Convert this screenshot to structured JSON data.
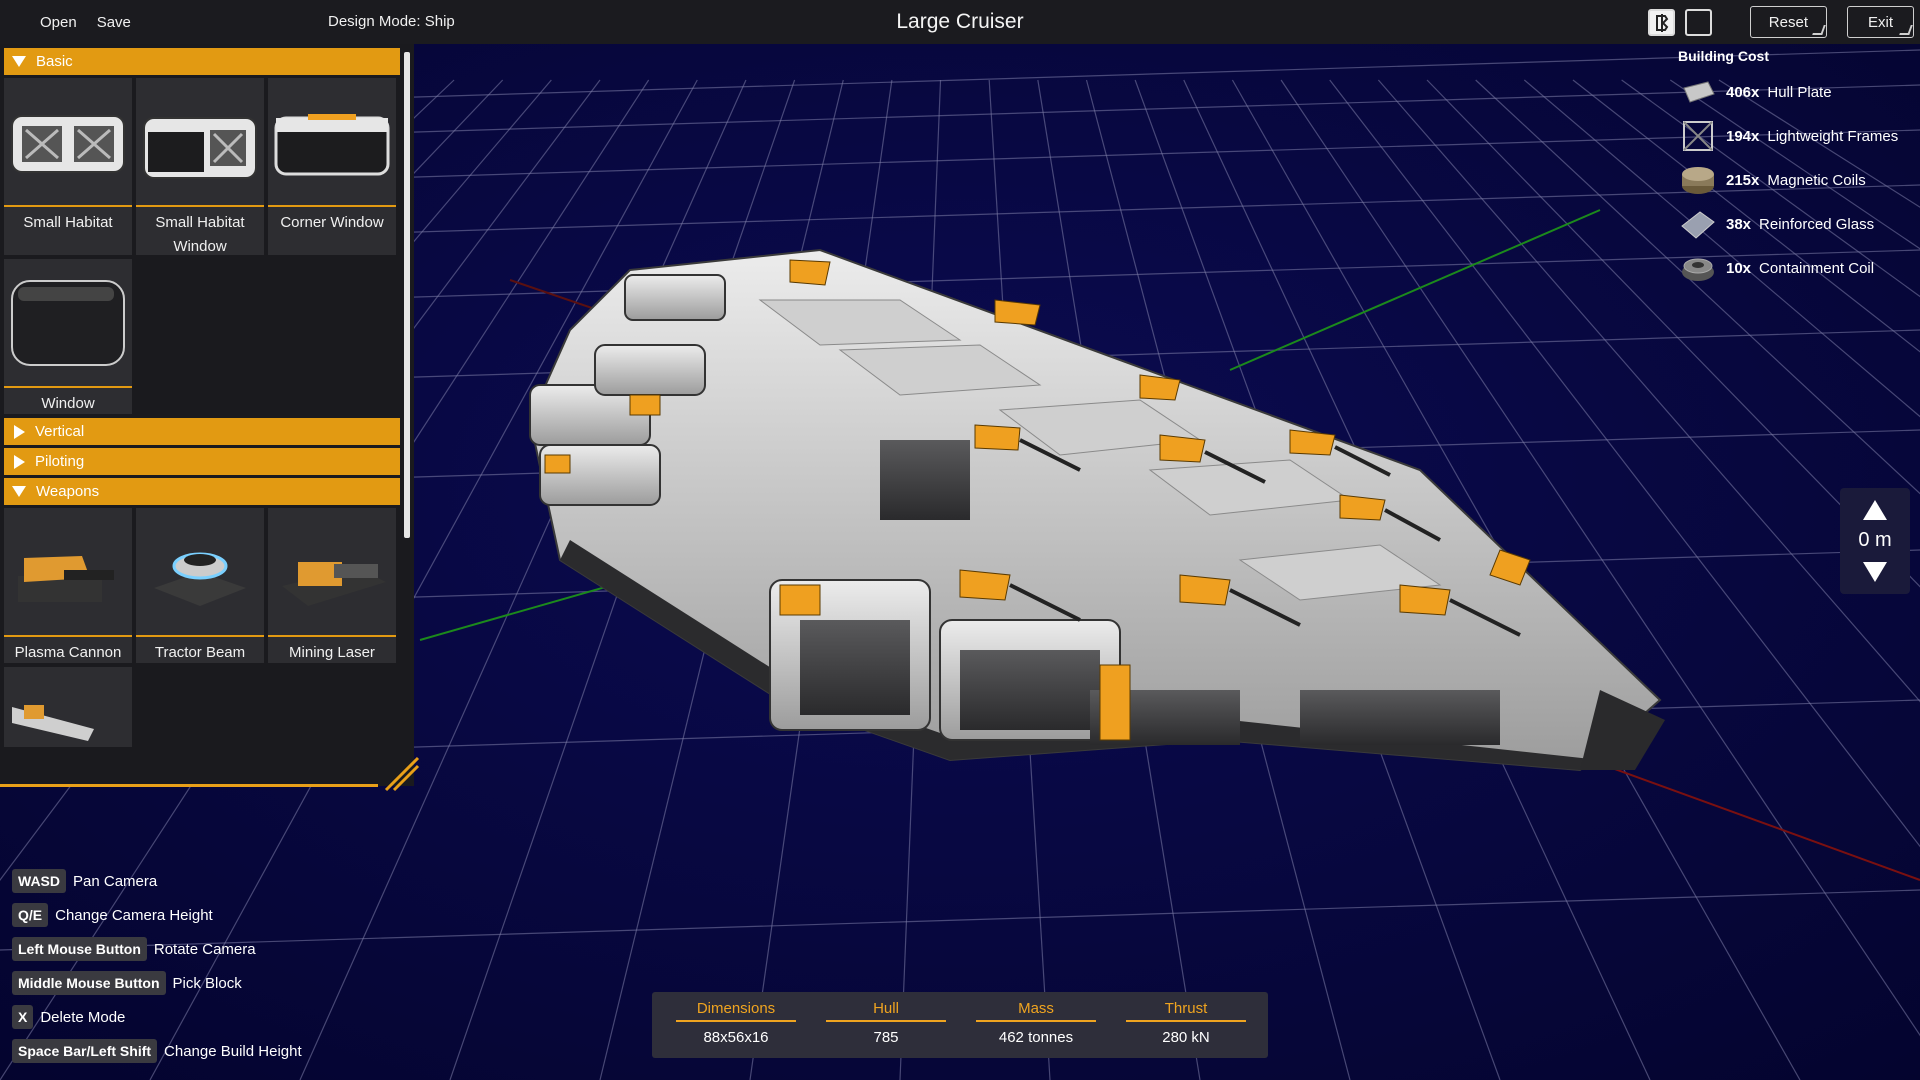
{
  "menu": {
    "open": "Open",
    "save": "Save",
    "design_mode": "Design Mode: Ship"
  },
  "title": "Large Cruiser",
  "controls": {
    "reset": "Reset",
    "exit": "Exit",
    "symmetry_on": "symmetry-mirror-icon",
    "symmetry_off": "symmetry-none-icon"
  },
  "palette": {
    "categories": [
      {
        "label": "Basic",
        "open": true
      },
      {
        "label": "Vertical",
        "open": false
      },
      {
        "label": "Piloting",
        "open": false
      },
      {
        "label": "Weapons",
        "open": true
      }
    ],
    "basic_items": [
      "Small Habitat",
      "Small Habitat Window",
      "Corner Window",
      "Window"
    ],
    "weapon_items": [
      "Plasma Cannon",
      "Tractor Beam",
      "Mining Laser"
    ]
  },
  "building_cost": {
    "heading": "Building Cost",
    "items": [
      {
        "qty": "406x",
        "label": "Hull Plate",
        "icon": "hull-plate-icon"
      },
      {
        "qty": "194x",
        "label": "Lightweight Frames",
        "icon": "frame-icon"
      },
      {
        "qty": "215x",
        "label": "Magnetic Coils",
        "icon": "coil-icon"
      },
      {
        "qty": "38x",
        "label": "Reinforced Glass",
        "icon": "glass-icon"
      },
      {
        "qty": "10x",
        "label": "Containment Coil",
        "icon": "containment-coil-icon"
      }
    ]
  },
  "build_height": {
    "value": "0 m"
  },
  "help": [
    {
      "key": "WASD",
      "desc": "Pan Camera"
    },
    {
      "key": "Q/E",
      "desc": "Change Camera Height"
    },
    {
      "key": "Left Mouse Button",
      "desc": "Rotate Camera"
    },
    {
      "key": "Middle Mouse Button",
      "desc": "Pick Block"
    },
    {
      "key": "X",
      "desc": "Delete Mode"
    },
    {
      "key": "Space Bar/Left Shift",
      "desc": "Change Build Height"
    }
  ],
  "stats": [
    {
      "label": "Dimensions",
      "value": "88x56x16"
    },
    {
      "label": "Hull",
      "value": "785"
    },
    {
      "label": "Mass",
      "value": "462 tonnes"
    },
    {
      "label": "Thrust",
      "value": "280 kN"
    }
  ],
  "colors": {
    "accent": "#e29a12",
    "panel": "#1a1a1e",
    "space": "#06063a"
  }
}
